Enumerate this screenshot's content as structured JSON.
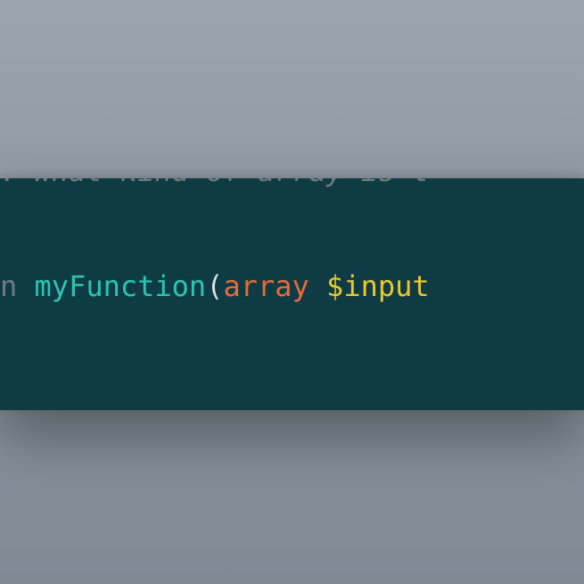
{
  "editor": {
    "lines": {
      "comment": {
        "prefix": ": ",
        "text": "What kind of array is t"
      },
      "signature": {
        "kw_fragment": "n ",
        "func_name": "myFunction",
        "open_paren": "(",
        "param_type": "array",
        "space": " ",
        "param_var": "$input"
      }
    }
  }
}
